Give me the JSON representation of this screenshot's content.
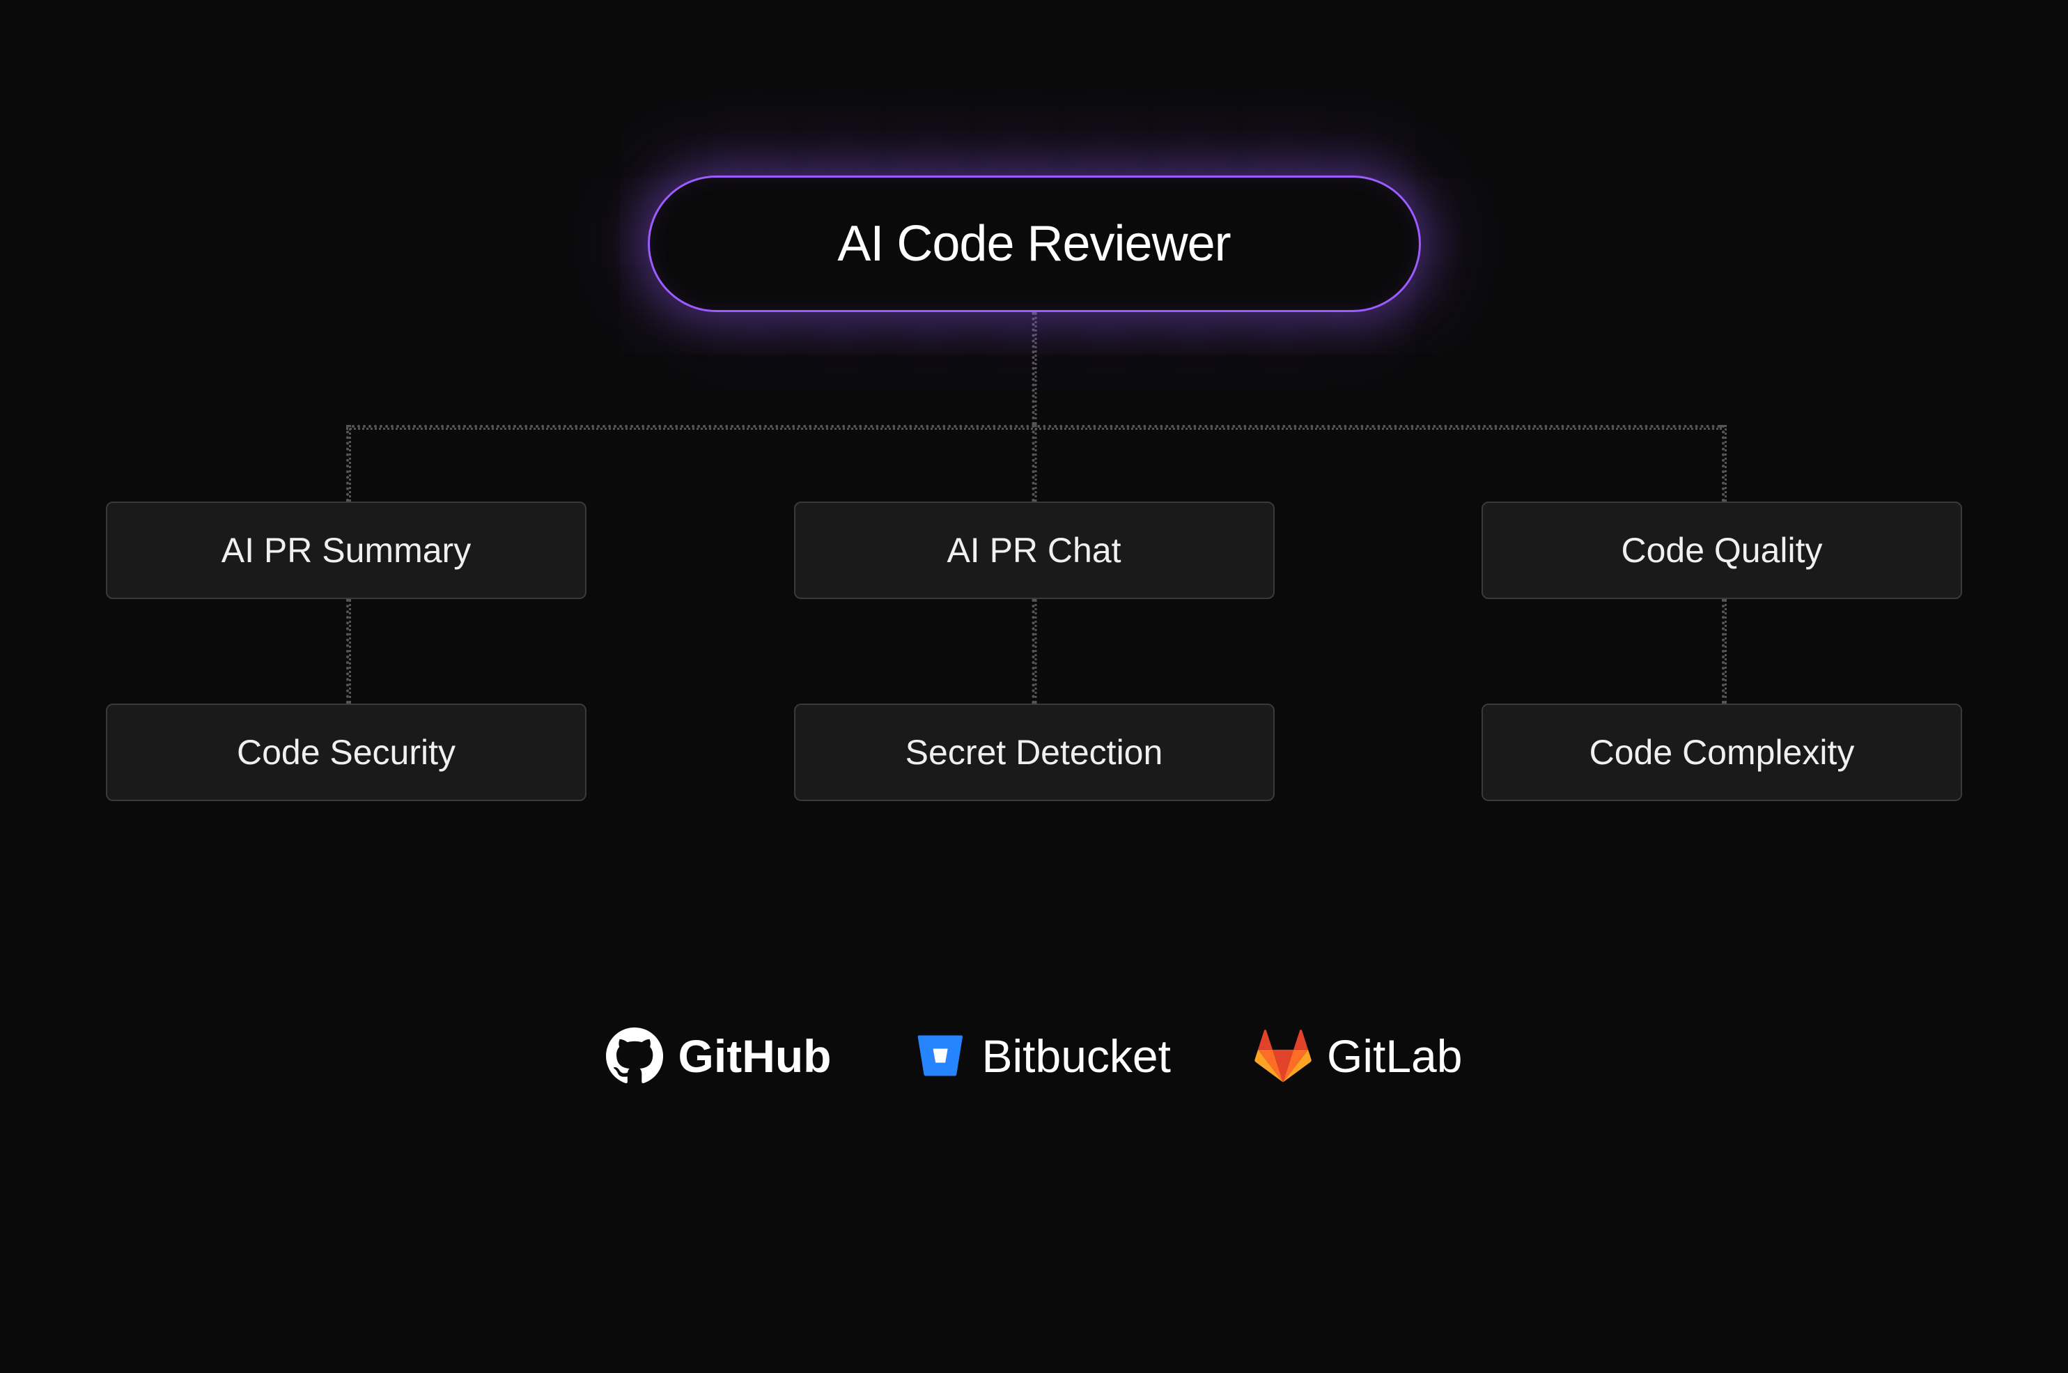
{
  "root": {
    "title": "AI Code Reviewer"
  },
  "features": {
    "row1": [
      {
        "label": "AI PR Summary"
      },
      {
        "label": "AI PR Chat"
      },
      {
        "label": "Code Quality"
      }
    ],
    "row2": [
      {
        "label": "Code Security"
      },
      {
        "label": "Secret Detection"
      },
      {
        "label": "Code Complexity"
      }
    ]
  },
  "integrations": [
    {
      "name": "GitHub"
    },
    {
      "name": "Bitbucket"
    },
    {
      "name": "GitLab"
    }
  ],
  "colors": {
    "accent": "#9d5cff",
    "background": "#0a0a0a",
    "boxBg": "#1a1a1a",
    "boxBorder": "#3a3a3a",
    "bitbucketBlue": "#2684ff",
    "gitlabOrange": "#fc6d26",
    "gitlabRed": "#e24329",
    "gitlabYellow": "#fca326"
  }
}
